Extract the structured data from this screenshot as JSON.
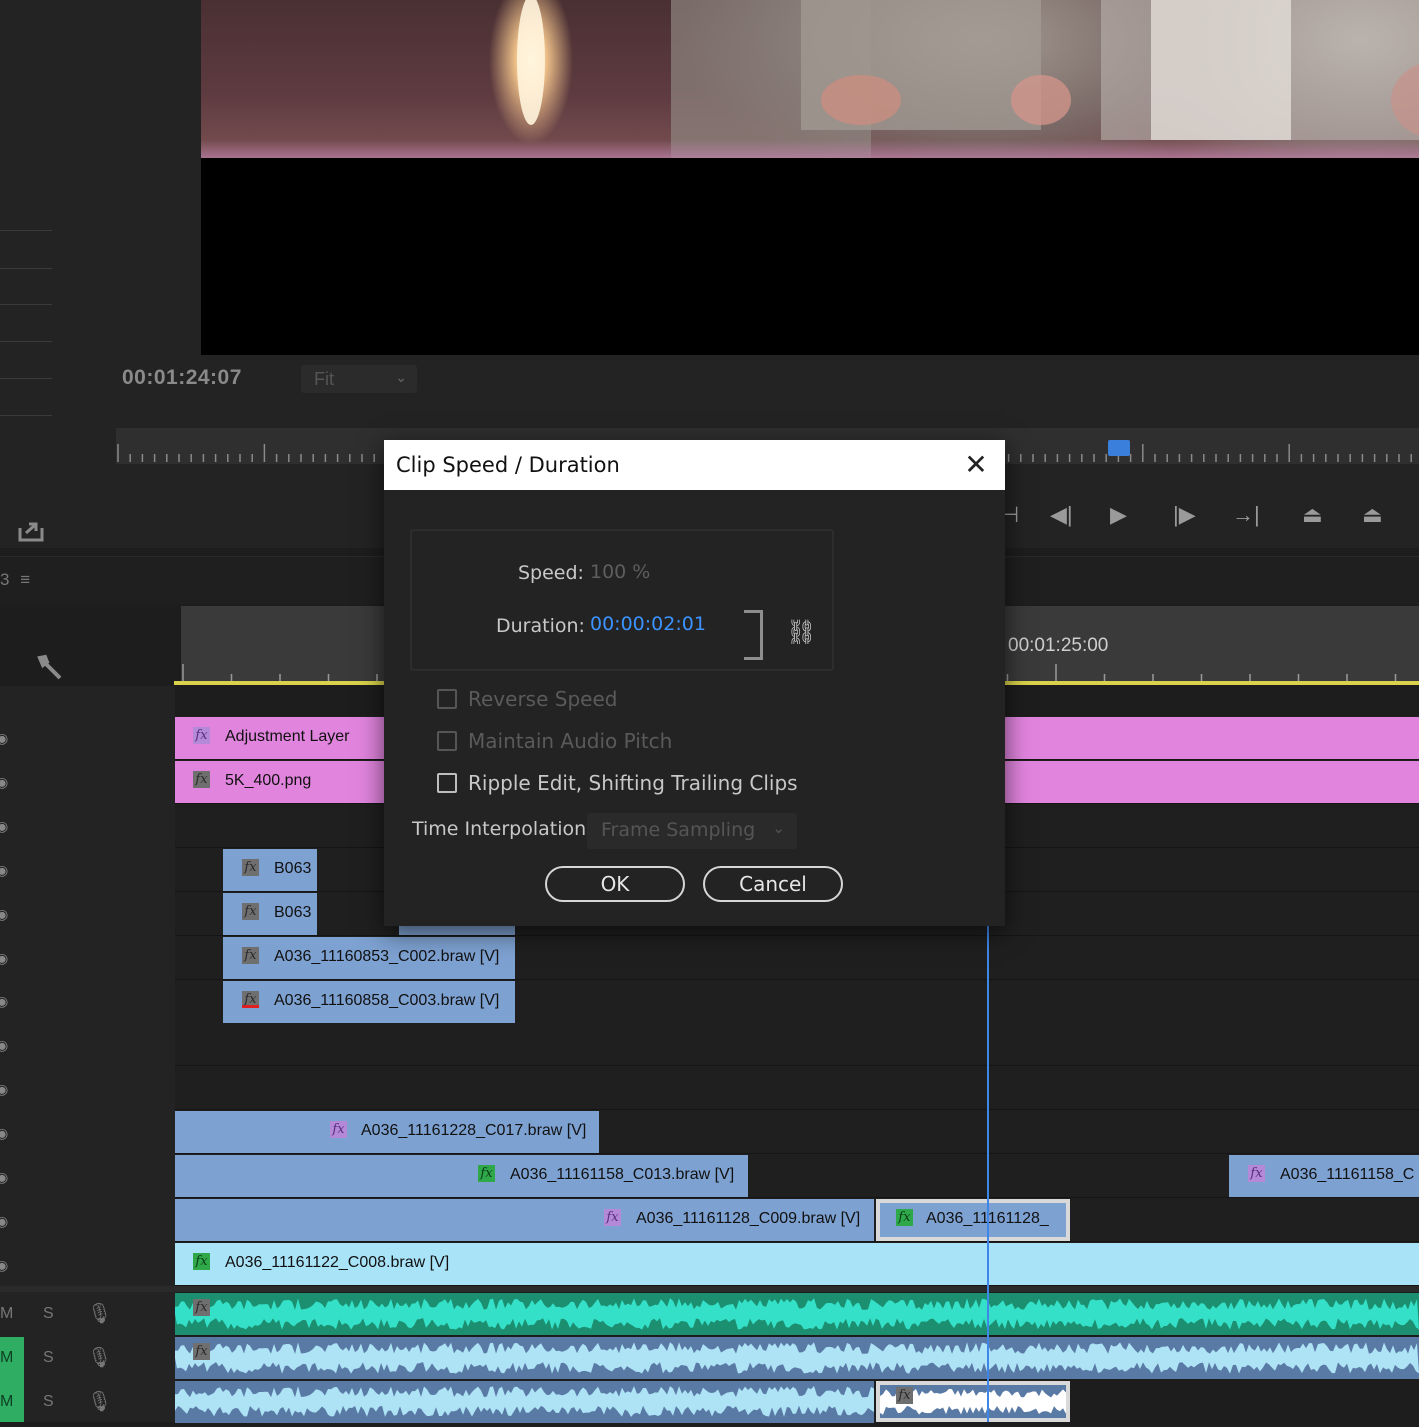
{
  "monitor": {
    "timecode": "00:01:24:07",
    "zoom": "Fit",
    "playhead_position": 0.77
  },
  "timeline": {
    "sequence_number": "3",
    "ruler_timecode": "00:01:25:00",
    "video_clips": {
      "v10": [
        {
          "label": "Adjustment Layer",
          "fx": "purple"
        }
      ],
      "v9": [
        {
          "label": "5K_400.png",
          "fx": "gray"
        }
      ],
      "v7": [
        {
          "label": "B063",
          "fx": "gray"
        }
      ],
      "v6": [
        {
          "label": "B063",
          "fx": "gray"
        }
      ],
      "v5": [
        {
          "label": "A036_11160853_C002.braw [V]",
          "fx": "gray"
        }
      ],
      "v4": [
        {
          "label": "A036_11160858_C003.braw [V]",
          "fx": "red"
        }
      ],
      "v3": [
        {
          "label": "A036_11161228_C017.braw [V]",
          "fx": "purple"
        }
      ],
      "v2": [
        {
          "label": "A036_11161158_C013.braw [V]",
          "fx": "green"
        },
        {
          "label": "A036_11161158_C",
          "fx": "purple"
        }
      ],
      "v1b": [
        {
          "label": "A036_11161128_C009.braw [V]",
          "fx": "purple"
        },
        {
          "label": "A036_11161128_",
          "fx": "green"
        }
      ],
      "v1": [
        {
          "label": "A036_11161122_C008.braw [V]",
          "fx": "green"
        }
      ]
    },
    "audio_tracks": [
      {
        "solo": "S",
        "mute": "M"
      },
      {
        "solo": "S",
        "mute": "M"
      },
      {
        "solo": "S",
        "mute": "M"
      }
    ],
    "fx_label": "fx",
    "colors": {
      "adjustment": "#e184de",
      "video_clip": "#7da1d1",
      "base_clip": "#a9e3f8",
      "audio_a1": "#35e0c8",
      "audio_a2": "#aee3f6",
      "playhead": "#3e86e8",
      "work_area": "#d9d24a"
    }
  },
  "dialog": {
    "title": "Clip Speed / Duration",
    "speed_label": "Speed:",
    "speed_value": "100 %",
    "duration_label": "Duration:",
    "duration_value": "00:00:02:01",
    "reverse_speed": "Reverse Speed",
    "maintain_pitch": "Maintain Audio Pitch",
    "ripple_edit": "Ripple Edit, Shifting Trailing Clips",
    "interp_label": "Time Interpolation:",
    "interp_value": "Frame Sampling",
    "ok": "OK",
    "cancel": "Cancel"
  }
}
